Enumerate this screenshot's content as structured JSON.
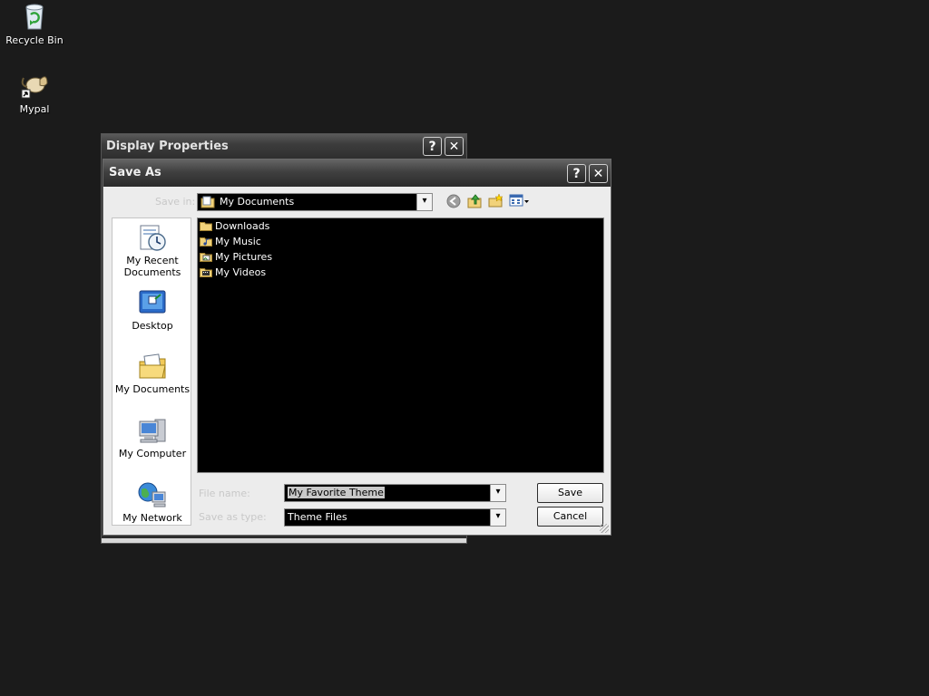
{
  "desktop": {
    "icons": [
      {
        "label": "Recycle Bin",
        "icon": "recycle-bin-icon"
      },
      {
        "label": "Mypal",
        "icon": "mypal-shortcut-icon"
      }
    ]
  },
  "background_window": {
    "title": "Display Properties",
    "help_glyph": "?",
    "close_glyph": "✕"
  },
  "dialog": {
    "title": "Save As",
    "help_glyph": "?",
    "close_glyph": "✕",
    "save_in_label": "Save in:",
    "save_in_value": "My Documents",
    "toolbar": [
      "back-icon",
      "up-folder-icon",
      "new-folder-icon",
      "views-menu-icon"
    ],
    "places": [
      {
        "label_line1": "My Recent",
        "label_line2": "Documents",
        "icon": "recent-documents-icon"
      },
      {
        "label_line1": "Desktop",
        "label_line2": "",
        "icon": "desktop-icon"
      },
      {
        "label_line1": "My Documents",
        "label_line2": "",
        "icon": "my-documents-icon"
      },
      {
        "label_line1": "My Computer",
        "label_line2": "",
        "icon": "my-computer-icon"
      },
      {
        "label_line1": "My Network",
        "label_line2": "",
        "icon": "my-network-icon"
      }
    ],
    "files": [
      {
        "name": "Downloads",
        "icon": "folder-icon"
      },
      {
        "name": "My Music",
        "icon": "music-folder-icon"
      },
      {
        "name": "My Pictures",
        "icon": "pictures-folder-icon"
      },
      {
        "name": "My Videos",
        "icon": "videos-folder-icon"
      }
    ],
    "file_name_label": "File name:",
    "file_name_value": "My Favorite Theme",
    "save_as_type_label": "Save as type:",
    "save_as_type_value": "Theme Files",
    "save_button": "Save",
    "cancel_button": "Cancel",
    "combo_arrow": "▾",
    "colors": {
      "file_list_bg": "#000000",
      "dialog_bg": "#ececec",
      "desktop_bg": "#1b1b1b"
    }
  }
}
